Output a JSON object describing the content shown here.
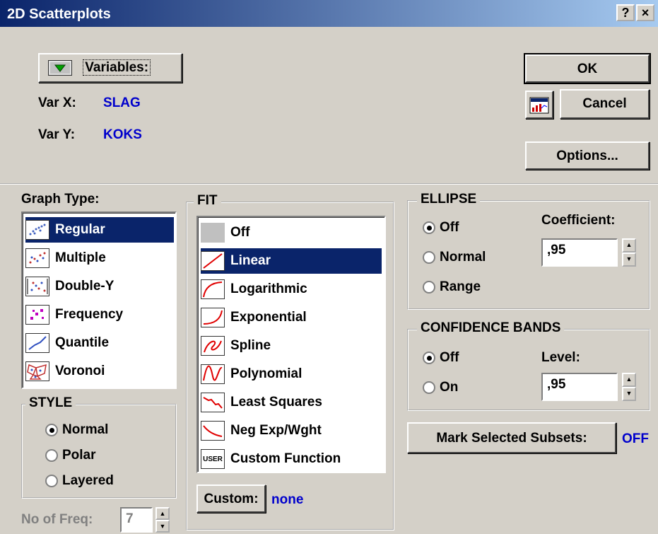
{
  "window": {
    "title": "2D Scatterplots",
    "help": "?",
    "close": "×"
  },
  "variables": {
    "button": "Variables:",
    "varx_label": "Var X:",
    "varx": "SLAG",
    "vary_label": "Var Y:",
    "vary": "KOKS"
  },
  "buttons": {
    "ok": "OK",
    "cancel": "Cancel",
    "options": "Options...",
    "custom": "Custom:",
    "mark": "Mark Selected Subsets:"
  },
  "graph_type": {
    "title": "Graph Type:",
    "items": [
      "Regular",
      "Multiple",
      "Double-Y",
      "Frequency",
      "Quantile",
      "Voronoi"
    ],
    "selected": "Regular"
  },
  "style": {
    "title": "STYLE",
    "options": [
      "Normal",
      "Polar",
      "Layered"
    ],
    "selected": "Normal"
  },
  "freq": {
    "label": "No of Freq:",
    "value": "7"
  },
  "fit": {
    "title": "FIT",
    "items": [
      "Off",
      "Linear",
      "Logarithmic",
      "Exponential",
      "Spline",
      "Polynomial",
      "Least Squares",
      "Neg Exp/Wght",
      "Custom Function"
    ],
    "selected": "Linear",
    "custom_value": "none"
  },
  "ellipse": {
    "title": "ELLIPSE",
    "options": [
      "Off",
      "Normal",
      "Range"
    ],
    "selected": "Off",
    "coef_label": "Coefficient:",
    "coef_value": ",95"
  },
  "confidence": {
    "title": "CONFIDENCE BANDS",
    "options": [
      "Off",
      "On"
    ],
    "selected": "Off",
    "level_label": "Level:",
    "level_value": ",95"
  },
  "mark": {
    "state": "OFF"
  }
}
